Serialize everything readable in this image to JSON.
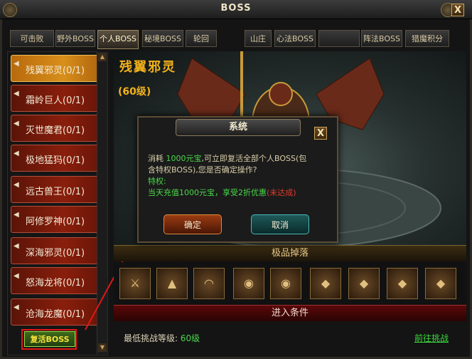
{
  "window": {
    "title": "BOSS",
    "close": "X"
  },
  "tabs": [
    "可击败",
    "野外BOSS",
    "个人BOSS",
    "秘境BOSS",
    "轮回",
    "山庄",
    "心法BOSS",
    "",
    "阵法BOSS",
    "猎魔积分"
  ],
  "active_tab": "个人BOSS",
  "boss_list": [
    {
      "label": "残翼邪灵(0/1)"
    },
    {
      "label": "霜岭巨人(0/1)"
    },
    {
      "label": "灭世魔君(0/1)"
    },
    {
      "label": "极地猛犸(0/1)"
    },
    {
      "label": "远古兽王(0/1)"
    },
    {
      "label": "阿修罗神(0/1)"
    },
    {
      "label": "深海邪灵(0/1)"
    },
    {
      "label": "怒海龙将(0/1)"
    },
    {
      "label": "沧海龙魔(0/1)"
    }
  ],
  "revive_button": "复活BOSS",
  "boss": {
    "name": "残翼邪灵",
    "level": "(60级)"
  },
  "drops": {
    "header": "极品掉落",
    "items": [
      "weapon-icon",
      "boots-icon",
      "fan-icon",
      "helmet-icon",
      "helmet-icon",
      "armor-icon",
      "armor-icon",
      "armor-icon",
      "armor-icon"
    ]
  },
  "conditions": {
    "header": "进入条件",
    "min_level_label": "最低挑战等级:",
    "min_level_value": "60级",
    "goto_label": "前往挑战"
  },
  "dialog": {
    "title": "系统",
    "close": "X",
    "line1_a": "消耗 ",
    "line1_cost": "1000元宝",
    "line1_b": ",可立即复活全部个人BOSS(包",
    "line2": "含特权BOSS),您是否确定操作?",
    "line3": "特权:",
    "line4": "当天充值1000元宝，享受2折优惠",
    "line4_status": "(未达成)",
    "ok": "确定",
    "cancel": "取消"
  }
}
